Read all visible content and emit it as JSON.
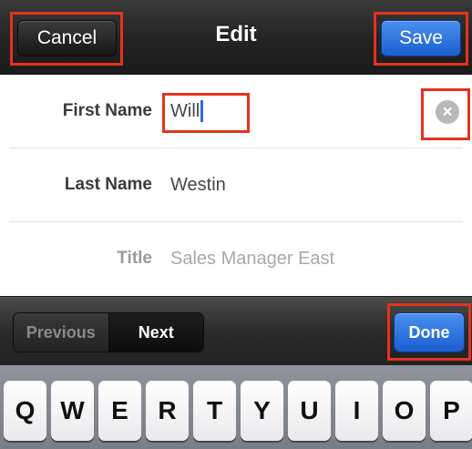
{
  "navbar": {
    "title": "Edit",
    "cancel_label": "Cancel",
    "save_label": "Save"
  },
  "form": {
    "first_name": {
      "label": "First Name",
      "value": "Will"
    },
    "last_name": {
      "label": "Last Name",
      "value": "Westin"
    },
    "title": {
      "label": "Title",
      "placeholder": "Sales Manager East"
    }
  },
  "accessory": {
    "previous_label": "Previous",
    "next_label": "Next",
    "done_label": "Done"
  },
  "keyboard": {
    "keys": [
      "Q",
      "W",
      "E",
      "R",
      "T",
      "Y",
      "U",
      "I",
      "O",
      "P"
    ]
  },
  "colors": {
    "highlight": "#e5321f",
    "accent_blue": "#2a6fdc",
    "caret": "#2f6ce0"
  },
  "icons": {
    "clear": "clear-icon"
  }
}
